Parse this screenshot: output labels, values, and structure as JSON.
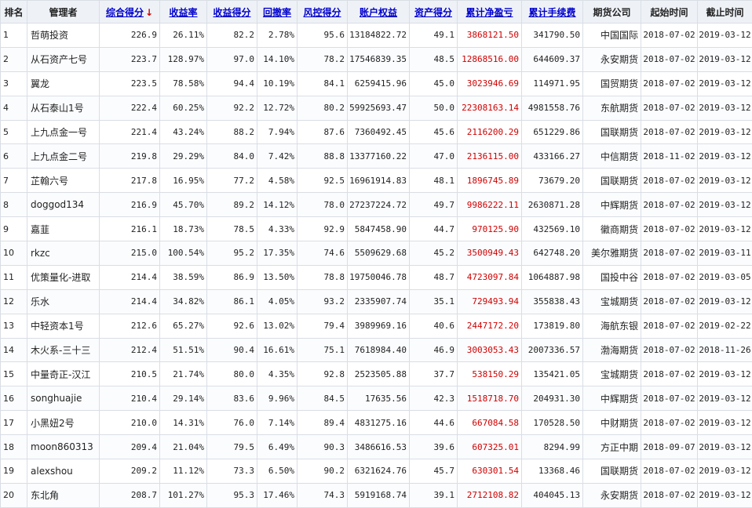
{
  "headers": {
    "rank": "排名",
    "manager": "管理者",
    "score": "综合得分",
    "return_rate": "收益率",
    "return_score": "收益得分",
    "drawdown": "回撤率",
    "risk_score": "风控得分",
    "equity": "账户权益",
    "asset_score": "资产得分",
    "net_profit": "累计净盈亏",
    "fees": "累计手续费",
    "company": "期货公司",
    "start": "起始时间",
    "end": "截止时间"
  },
  "sort_icon": "down-arrow-icon",
  "colors": {
    "header_bg": "#eef2f7",
    "link": "#0000cc",
    "profit": "#d00000"
  },
  "rows": [
    {
      "rank": "1",
      "manager": "哲萌投资",
      "score": "226.9",
      "return_rate": "26.11%",
      "return_score": "82.2",
      "drawdown": "2.78%",
      "risk_score": "95.6",
      "equity": "13184822.72",
      "asset_score": "49.1",
      "net_profit": "3868121.50",
      "fees": "341790.50",
      "company": "中国国际",
      "start": "2018-07-02",
      "end": "2019-03-12"
    },
    {
      "rank": "2",
      "manager": "从石资产七号",
      "score": "223.7",
      "return_rate": "128.97%",
      "return_score": "97.0",
      "drawdown": "14.10%",
      "risk_score": "78.2",
      "equity": "17546839.35",
      "asset_score": "48.5",
      "net_profit": "12868516.00",
      "fees": "644609.37",
      "company": "永安期货",
      "start": "2018-07-02",
      "end": "2019-03-12"
    },
    {
      "rank": "3",
      "manager": "翼龙",
      "score": "223.5",
      "return_rate": "78.58%",
      "return_score": "94.4",
      "drawdown": "10.19%",
      "risk_score": "84.1",
      "equity": "6259415.96",
      "asset_score": "45.0",
      "net_profit": "3023946.69",
      "fees": "114971.95",
      "company": "国贸期货",
      "start": "2018-07-02",
      "end": "2019-03-12"
    },
    {
      "rank": "4",
      "manager": "从石泰山1号",
      "score": "222.4",
      "return_rate": "60.25%",
      "return_score": "92.2",
      "drawdown": "12.72%",
      "risk_score": "80.2",
      "equity": "59925693.47",
      "asset_score": "50.0",
      "net_profit": "22308163.14",
      "fees": "4981558.76",
      "company": "东航期货",
      "start": "2018-07-02",
      "end": "2019-03-12"
    },
    {
      "rank": "5",
      "manager": "上九点金一号",
      "score": "221.4",
      "return_rate": "43.24%",
      "return_score": "88.2",
      "drawdown": "7.94%",
      "risk_score": "87.6",
      "equity": "7360492.45",
      "asset_score": "45.6",
      "net_profit": "2116200.29",
      "fees": "651229.86",
      "company": "国联期货",
      "start": "2018-07-02",
      "end": "2019-03-12"
    },
    {
      "rank": "6",
      "manager": "上九点金二号",
      "score": "219.8",
      "return_rate": "29.29%",
      "return_score": "84.0",
      "drawdown": "7.42%",
      "risk_score": "88.8",
      "equity": "13377160.22",
      "asset_score": "47.0",
      "net_profit": "2136115.00",
      "fees": "433166.27",
      "company": "中信期货",
      "start": "2018-11-02",
      "end": "2019-03-12"
    },
    {
      "rank": "7",
      "manager": "芷翰六号",
      "score": "217.8",
      "return_rate": "16.95%",
      "return_score": "77.2",
      "drawdown": "4.58%",
      "risk_score": "92.5",
      "equity": "16961914.83",
      "asset_score": "48.1",
      "net_profit": "1896745.89",
      "fees": "73679.20",
      "company": "国联期货",
      "start": "2018-07-02",
      "end": "2019-03-12"
    },
    {
      "rank": "8",
      "manager": "doggod134",
      "score": "216.9",
      "return_rate": "45.70%",
      "return_score": "89.2",
      "drawdown": "14.12%",
      "risk_score": "78.0",
      "equity": "27237224.72",
      "asset_score": "49.7",
      "net_profit": "9986222.11",
      "fees": "2630871.28",
      "company": "中辉期货",
      "start": "2018-07-02",
      "end": "2019-03-12"
    },
    {
      "rank": "9",
      "manager": "嘉韮",
      "score": "216.1",
      "return_rate": "18.73%",
      "return_score": "78.5",
      "drawdown": "4.33%",
      "risk_score": "92.9",
      "equity": "5847458.90",
      "asset_score": "44.7",
      "net_profit": "970125.90",
      "fees": "432569.10",
      "company": "徽商期货",
      "start": "2018-07-02",
      "end": "2019-03-12"
    },
    {
      "rank": "10",
      "manager": "rkzc",
      "score": "215.0",
      "return_rate": "100.54%",
      "return_score": "95.2",
      "drawdown": "17.35%",
      "risk_score": "74.6",
      "equity": "5509629.68",
      "asset_score": "45.2",
      "net_profit": "3500949.43",
      "fees": "642748.20",
      "company": "美尔雅期货",
      "start": "2018-07-02",
      "end": "2019-03-11"
    },
    {
      "rank": "11",
      "manager": "优策量化-进取",
      "score": "214.4",
      "return_rate": "38.59%",
      "return_score": "86.9",
      "drawdown": "13.50%",
      "risk_score": "78.8",
      "equity": "19750046.78",
      "asset_score": "48.7",
      "net_profit": "4723097.84",
      "fees": "1064887.98",
      "company": "国投中谷",
      "start": "2018-07-02",
      "end": "2019-03-05"
    },
    {
      "rank": "12",
      "manager": "乐水",
      "score": "214.4",
      "return_rate": "34.82%",
      "return_score": "86.1",
      "drawdown": "4.05%",
      "risk_score": "93.2",
      "equity": "2335907.74",
      "asset_score": "35.1",
      "net_profit": "729493.94",
      "fees": "355838.43",
      "company": "宝城期货",
      "start": "2018-07-02",
      "end": "2019-03-12"
    },
    {
      "rank": "13",
      "manager": "中轻资本1号",
      "score": "212.6",
      "return_rate": "65.27%",
      "return_score": "92.6",
      "drawdown": "13.02%",
      "risk_score": "79.4",
      "equity": "3989969.16",
      "asset_score": "40.6",
      "net_profit": "2447172.20",
      "fees": "173819.80",
      "company": "海航东银",
      "start": "2018-07-02",
      "end": "2019-02-22"
    },
    {
      "rank": "14",
      "manager": "木火系-三十三",
      "score": "212.4",
      "return_rate": "51.51%",
      "return_score": "90.4",
      "drawdown": "16.61%",
      "risk_score": "75.1",
      "equity": "7618984.40",
      "asset_score": "46.9",
      "net_profit": "3003053.43",
      "fees": "2007336.57",
      "company": "渤海期货",
      "start": "2018-07-02",
      "end": "2018-11-26"
    },
    {
      "rank": "15",
      "manager": "中量奇正-汉江",
      "score": "210.5",
      "return_rate": "21.74%",
      "return_score": "80.0",
      "drawdown": "4.35%",
      "risk_score": "92.8",
      "equity": "2523505.88",
      "asset_score": "37.7",
      "net_profit": "538150.29",
      "fees": "135421.05",
      "company": "宝城期货",
      "start": "2018-07-02",
      "end": "2019-03-12"
    },
    {
      "rank": "16",
      "manager": "songhuajie",
      "score": "210.4",
      "return_rate": "29.14%",
      "return_score": "83.6",
      "drawdown": "9.96%",
      "risk_score": "84.5",
      "equity": "17635.56",
      "asset_score": "42.3",
      "net_profit": "1518718.70",
      "fees": "204931.30",
      "company": "中辉期货",
      "start": "2018-07-02",
      "end": "2019-03-12"
    },
    {
      "rank": "17",
      "manager": "小黑妞2号",
      "score": "210.0",
      "return_rate": "14.31%",
      "return_score": "76.0",
      "drawdown": "7.14%",
      "risk_score": "89.4",
      "equity": "4831275.16",
      "asset_score": "44.6",
      "net_profit": "667084.58",
      "fees": "170528.50",
      "company": "中财期货",
      "start": "2018-07-02",
      "end": "2019-03-12"
    },
    {
      "rank": "18",
      "manager": "moon860313",
      "score": "209.4",
      "return_rate": "21.04%",
      "return_score": "79.5",
      "drawdown": "6.49%",
      "risk_score": "90.3",
      "equity": "3486616.53",
      "asset_score": "39.6",
      "net_profit": "607325.01",
      "fees": "8294.99",
      "company": "方正中期",
      "start": "2018-09-07",
      "end": "2019-03-12"
    },
    {
      "rank": "19",
      "manager": "alexshou",
      "score": "209.2",
      "return_rate": "11.12%",
      "return_score": "73.3",
      "drawdown": "6.50%",
      "risk_score": "90.2",
      "equity": "6321624.76",
      "asset_score": "45.7",
      "net_profit": "630301.54",
      "fees": "13368.46",
      "company": "国联期货",
      "start": "2018-07-02",
      "end": "2019-03-12"
    },
    {
      "rank": "20",
      "manager": "东北角",
      "score": "208.7",
      "return_rate": "101.27%",
      "return_score": "95.3",
      "drawdown": "17.46%",
      "risk_score": "74.3",
      "equity": "5919168.74",
      "asset_score": "39.1",
      "net_profit": "2712108.82",
      "fees": "404045.13",
      "company": "永安期货",
      "start": "2018-07-02",
      "end": "2019-03-12"
    }
  ]
}
